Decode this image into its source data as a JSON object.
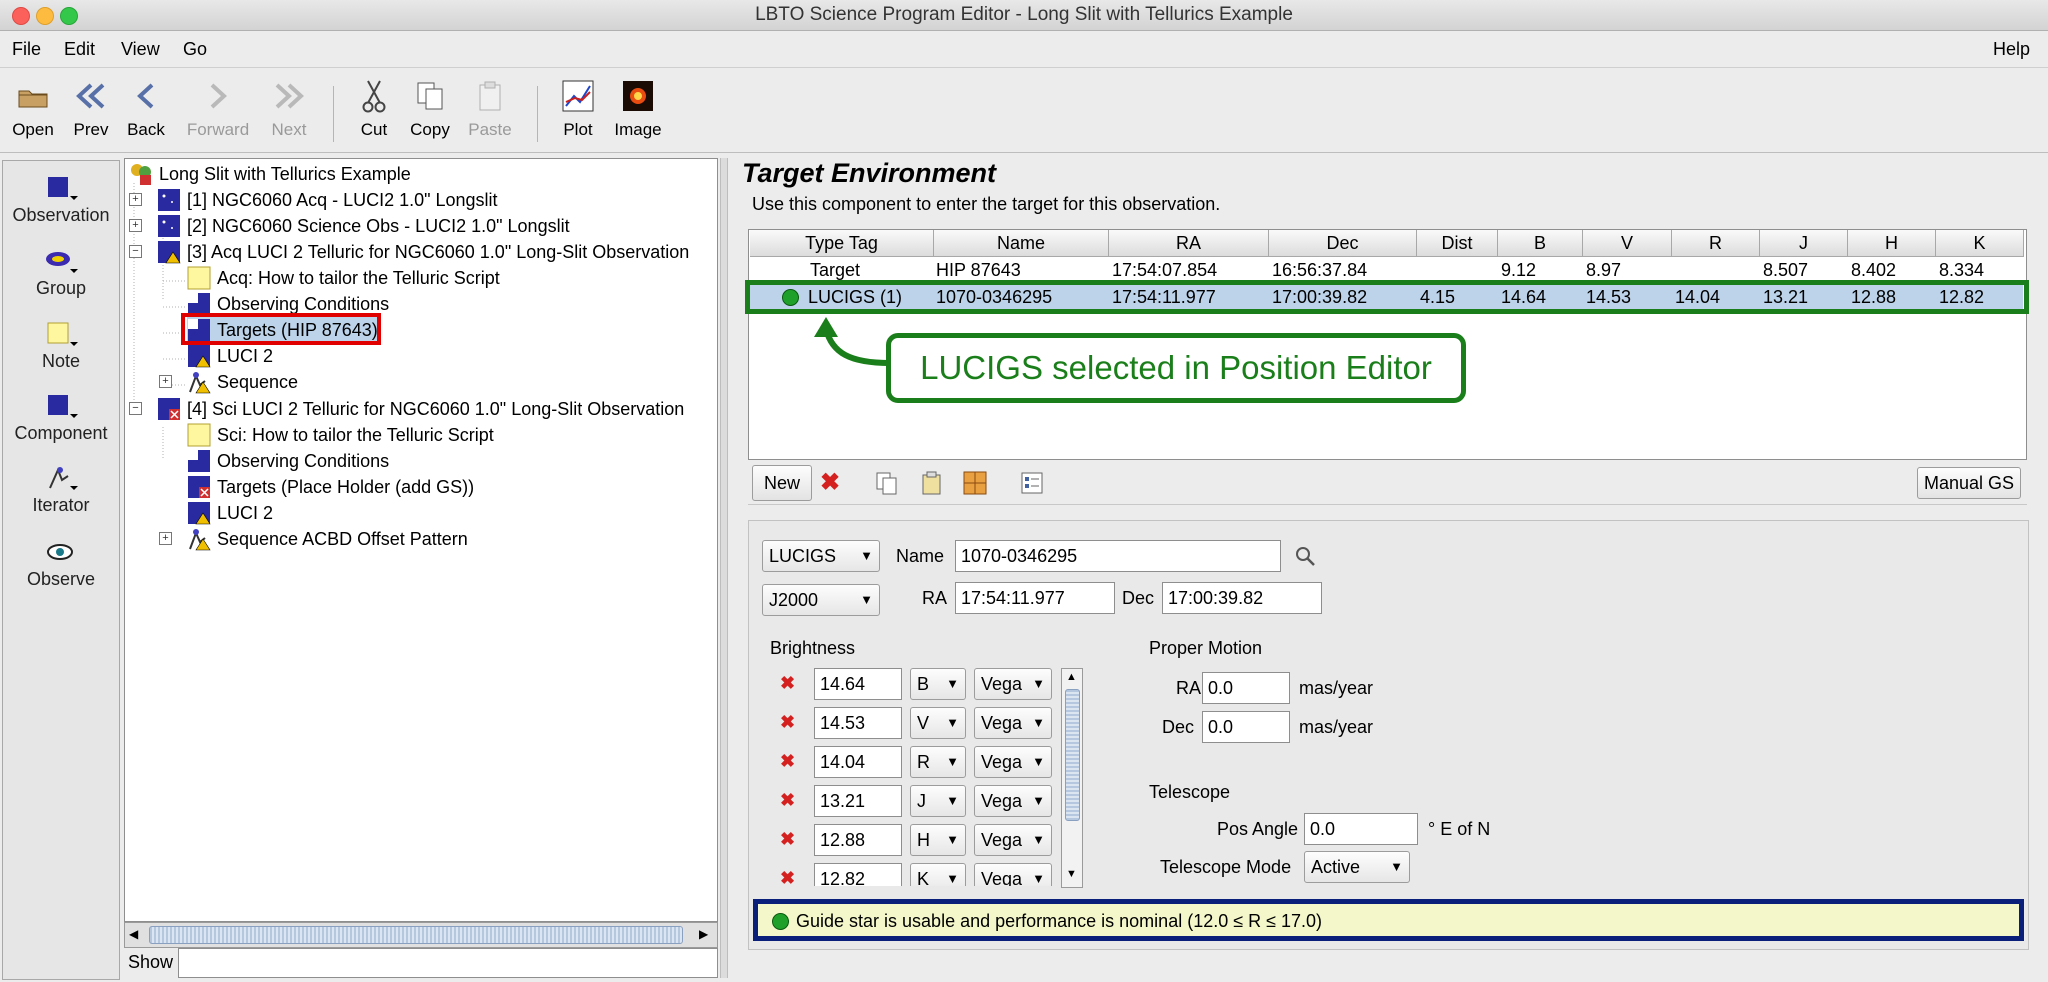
{
  "window": {
    "title": "LBTO Science Program Editor - Long Slit with Tellurics Example"
  },
  "menus": {
    "file": "File",
    "edit": "Edit",
    "view": "View",
    "go": "Go",
    "help": "Help"
  },
  "toolbar": {
    "open": "Open",
    "prev": "Prev",
    "back": "Back",
    "forward": "Forward",
    "next": "Next",
    "cut": "Cut",
    "copy": "Copy",
    "paste": "Paste",
    "plot": "Plot",
    "image": "Image"
  },
  "palette": {
    "observation": "Observation",
    "group": "Group",
    "note": "Note",
    "component": "Component",
    "iterator": "Iterator",
    "observe": "Observe"
  },
  "tree": {
    "root": "Long Slit with Tellurics Example",
    "obs1": "[1] NGC6060 Acq - LUCI2 1.0\" Longslit",
    "obs2": "[2] NGC6060 Science Obs - LUCI2 1.0\" Longslit",
    "obs3": "[3] Acq LUCI 2 Telluric for NGC6060 1.0\" Long-Slit Observation",
    "obs3_note": "Acq: How to tailor the Telluric Script",
    "obs3_cond": "Observing Conditions",
    "obs3_targets": "Targets (HIP 87643)",
    "obs3_luci": "LUCI 2",
    "obs3_seq": "Sequence",
    "obs4": "[4] Sci LUCI 2 Telluric for NGC6060 1.0\" Long-Slit Observation",
    "obs4_note": "Sci: How to tailor the Telluric Script",
    "obs4_cond": "Observing Conditions",
    "obs4_targets": "Targets (Place Holder (add GS))",
    "obs4_luci": "LUCI 2",
    "obs4_seq": "Sequence ACBD Offset Pattern"
  },
  "show": {
    "label": "Show",
    "value": ""
  },
  "target_env": {
    "title": "Target Environment",
    "subtitle": "Use this component to enter the target for this observation.",
    "columns": [
      "Type Tag",
      "Name",
      "RA",
      "Dec",
      "Dist",
      "B",
      "V",
      "R",
      "J",
      "H",
      "K"
    ],
    "rows": [
      {
        "type": "Target",
        "name": "HIP 87643",
        "ra": "17:54:07.854",
        "dec": "16:56:37.84",
        "dist": "",
        "b": "9.12",
        "v": "8.97",
        "r": "",
        "j": "8.507",
        "h": "8.402",
        "k": "8.334"
      },
      {
        "type": "LUCIGS (1)",
        "name": "1070-0346295",
        "ra": "17:54:11.977",
        "dec": "17:00:39.82",
        "dist": "4.15",
        "b": "14.64",
        "v": "14.53",
        "r": "14.04",
        "j": "13.21",
        "h": "12.88",
        "k": "12.82"
      }
    ],
    "callout": "LUCIGS selected in Position Editor",
    "new_button": "New",
    "manual_gs_button": "Manual GS"
  },
  "editor": {
    "tag_select": "LUCIGS",
    "name_label": "Name",
    "name_value": "1070-0346295",
    "system_select": "J2000",
    "ra_label": "RA",
    "ra_value": "17:54:11.977",
    "dec_label": "Dec",
    "dec_value": "17:00:39.82",
    "brightness_label": "Brightness",
    "brightness": [
      {
        "value": "14.64",
        "band": "B",
        "system": "Vega"
      },
      {
        "value": "14.53",
        "band": "V",
        "system": "Vega"
      },
      {
        "value": "14.04",
        "band": "R",
        "system": "Vega"
      },
      {
        "value": "13.21",
        "band": "J",
        "system": "Vega"
      },
      {
        "value": "12.88",
        "band": "H",
        "system": "Vega"
      },
      {
        "value": "12.82",
        "band": "K",
        "system": "Vega"
      }
    ],
    "proper_motion_label": "Proper Motion",
    "pm_ra_label": "RA",
    "pm_ra_value": "0.0",
    "pm_dec_label": "Dec",
    "pm_dec_value": "0.0",
    "pm_unit": "mas/year",
    "telescope_label": "Telescope",
    "pos_angle_label": "Pos Angle",
    "pos_angle_value": "0.0",
    "pos_angle_unit": "° E of N",
    "telescope_mode_label": "Telescope Mode",
    "telescope_mode_value": "Active"
  },
  "status": {
    "message": "Guide star is usable and performance is nominal (12.0 ≤ R ≤ 17.0)"
  },
  "colors": {
    "annotation_green": "#1a7f1a",
    "annotation_red": "#e00000",
    "annotation_navy": "#0a1f7a",
    "status_bg": "#f4f7c9",
    "selection_bg": "#bcd3ea"
  }
}
